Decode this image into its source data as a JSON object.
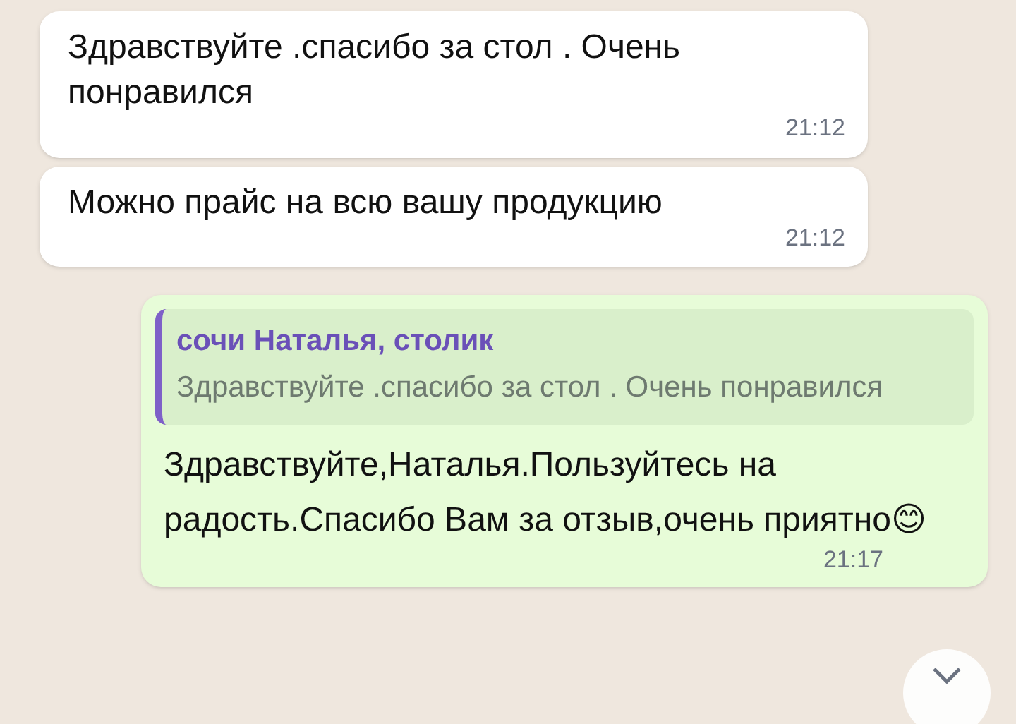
{
  "messages": [
    {
      "kind": "incoming",
      "text": "Здравствуйте .спасибо за стол . Очень понравился",
      "time": "21:12"
    },
    {
      "kind": "incoming",
      "text": "Можно прайс на всю вашу продукцию",
      "time": "21:12"
    },
    {
      "kind": "outgoing",
      "quote": {
        "author": "сочи Наталья, столик",
        "text": "Здравствуйте .спасибо за стол . Очень понравился"
      },
      "text": "Здравствуйте,Наталья.Пользуйтесь на радость.Спасибо Вам за отзыв,очень приятно",
      "emoji": "😊",
      "time": "21:17"
    }
  ]
}
